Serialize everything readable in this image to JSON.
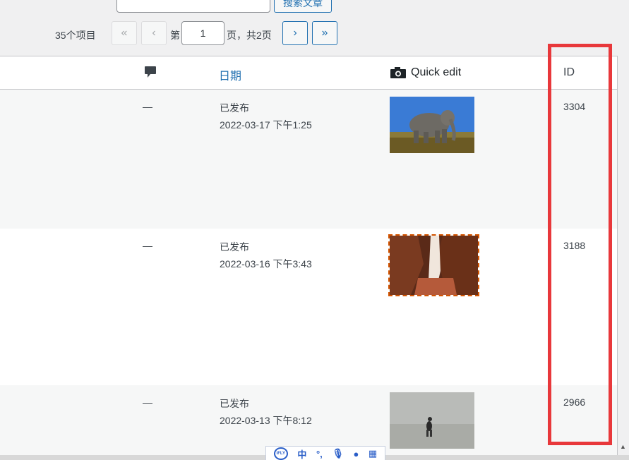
{
  "toolbar": {
    "search_button_label": "搜索文章"
  },
  "pagination": {
    "items_count": "35个项目",
    "first_label": "«",
    "prev_label": "‹",
    "page_prefix": "第",
    "current_page": "1",
    "page_suffix": "页，共2页",
    "next_label": "›",
    "last_label": "»"
  },
  "table": {
    "columns": {
      "date": "日期",
      "quick_edit": "Quick edit",
      "id": "ID"
    },
    "rows": [
      {
        "comments": "—",
        "status": "已发布",
        "datetime": "2022-03-17 下午1:25",
        "thumbnail": "elephant",
        "id": "3304"
      },
      {
        "comments": "—",
        "status": "已发布",
        "datetime": "2022-03-16 下午3:43",
        "thumbnail": "canyon",
        "id": "3188"
      },
      {
        "comments": "—",
        "status": "已发布",
        "datetime": "2022-03-13 下午8:12",
        "thumbnail": "fog-figure",
        "id": "2966"
      }
    ]
  },
  "ime": {
    "logo": "iFLY",
    "mode": "中"
  },
  "colors": {
    "accent": "#2271b1",
    "highlight": "#e8383b",
    "hover_outline": "#d35400"
  }
}
